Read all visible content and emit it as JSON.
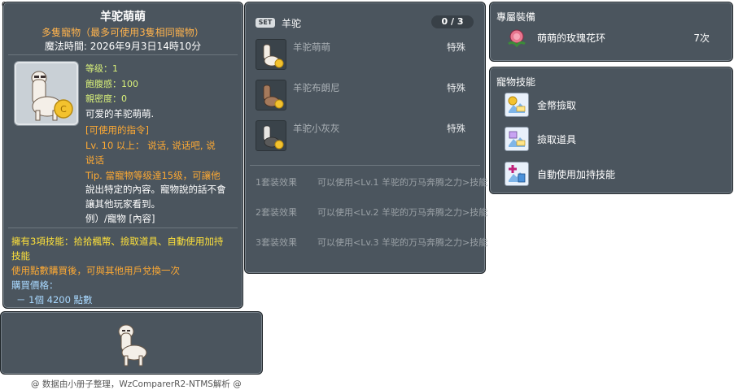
{
  "item_id": "05000718",
  "tooltip": {
    "title": "羊驼萌萌",
    "subtitle": "多隻寵物（最多可使用3隻相同寵物）",
    "magic_time": "魔法時間: 2026年9月3日14時10分",
    "stats": {
      "level": "等级：1",
      "fullness": "飽腹感：100",
      "closeness": "親密度：0"
    },
    "desc_main": "可爱的羊驼萌萌.",
    "commands_header": "[可使用的指令]",
    "commands_line1": "Lv. 10 以上： 说话, 说话吧, 说",
    "commands_line2": "说话",
    "tip_line1": "Tip. 當寵物等级達15级，可讓他",
    "tip_line2": "說出特定的內容。寵物說的話不會",
    "tip_line3": "讓其他玩家看到。",
    "tip_line4": "例）/寵物 [內容]",
    "skills_line1": "擁有3項技能：拾拾楓幣、撿取道具、自動使用加持",
    "skills_line2": "技能",
    "exchange": "使用點數購買後，可與其他用戶兌換一次",
    "price_label": "購買價格：",
    "price_value": "－ 1個 4200 點數"
  },
  "set": {
    "badge": "SET",
    "name": "羊驼",
    "count": "0 / 3",
    "items": [
      {
        "name": "羊驼萌萌",
        "type": "特殊"
      },
      {
        "name": "羊驼布朗尼",
        "type": "特殊"
      },
      {
        "name": "羊驼小灰灰",
        "type": "特殊"
      }
    ],
    "effects": [
      {
        "key": "1套装效果",
        "value": "可以使用<Lv.1 羊驼的万马奔腾之力>技能"
      },
      {
        "key": "2套装效果",
        "value": "可以使用<Lv.2 羊驼的万马奔腾之力>技能"
      },
      {
        "key": "3套装效果",
        "value": "可以使用<Lv.3 羊驼的万马奔腾之力>技能"
      }
    ]
  },
  "exclusive": {
    "title": "專屬裝備",
    "item_name": "萌萌的玫瑰花环",
    "item_count": "7次"
  },
  "skills": {
    "title": "寵物技能",
    "items": [
      {
        "label": "金幣撿取",
        "icon": "coin-pickup-icon"
      },
      {
        "label": "撿取道具",
        "icon": "item-pickup-icon"
      },
      {
        "label": "自動使用加持技能",
        "icon": "auto-buff-icon"
      }
    ]
  },
  "footer": "@ 数据由小册子整理，WzComparerR2-NTMS解析 @",
  "colors": {
    "panel_bg": "#4b555e",
    "subtitle_orange": "#ffb34d",
    "stat_green": "#d8f07a",
    "command_orange": "#ffaa33",
    "skills_yellow": "#ffe23a",
    "price_blue": "#a8d8ff"
  }
}
